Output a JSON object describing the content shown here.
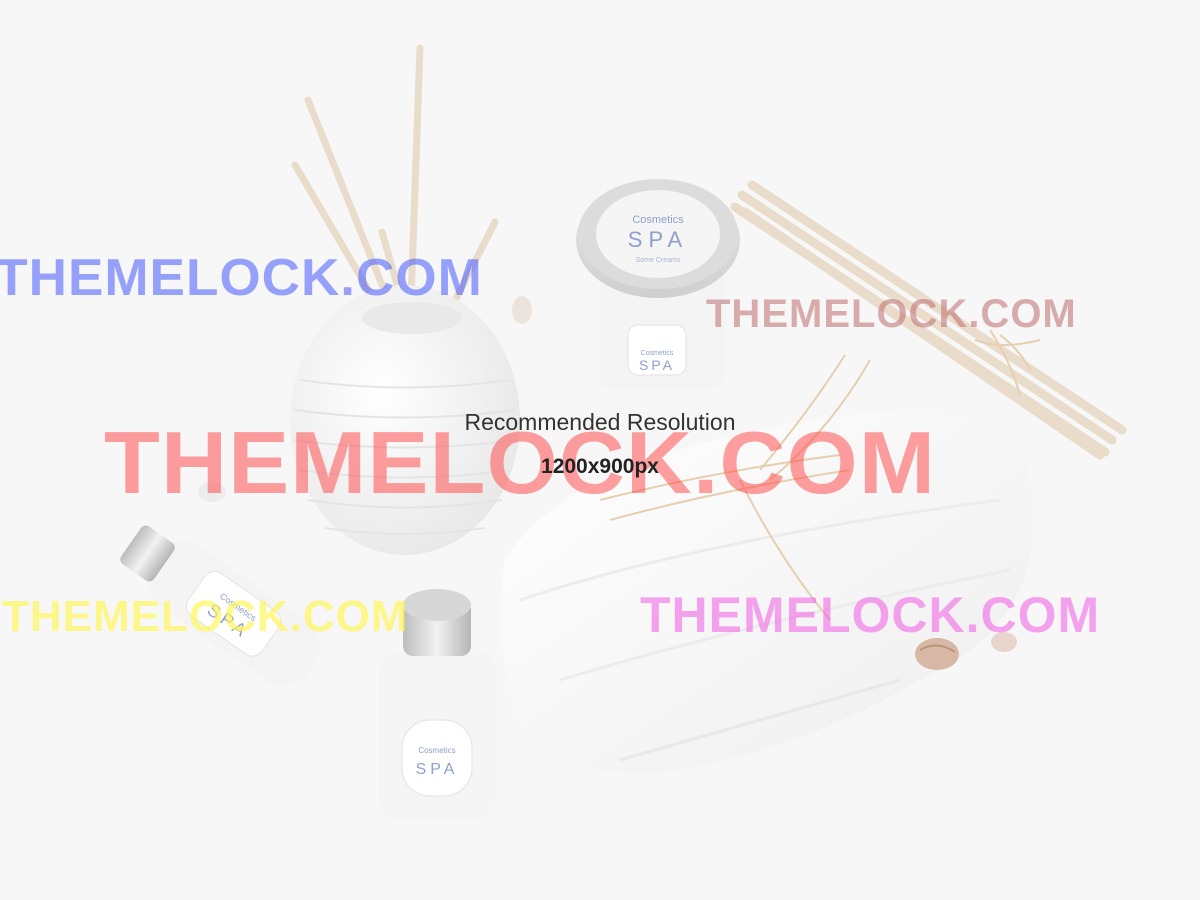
{
  "caption": {
    "title": "Recommended Resolution",
    "resolution": "1200x900px"
  },
  "watermarks": [
    {
      "text": "THEMELOCK.COM",
      "color": "#4a5cff"
    },
    {
      "text": "THEMELOCK.COM",
      "color": "#c07070"
    },
    {
      "text": "THEMELOCK.COM",
      "color": "#ff5050"
    },
    {
      "text": "THEMELOCK.COM",
      "color": "#fff55a"
    },
    {
      "text": "THEMELOCK.COM",
      "color": "#f05ae6"
    }
  ],
  "labels": {
    "jar_brand": "Cosmetics",
    "jar_name": "SPA",
    "jar_sub": "Some Creams",
    "bottle_brand": "Cosmetics",
    "bottle_name": "SPA"
  },
  "colors": {
    "background": "#f7f7f7",
    "reed": "#e9dccb",
    "label_text": "#8ea0cc"
  }
}
